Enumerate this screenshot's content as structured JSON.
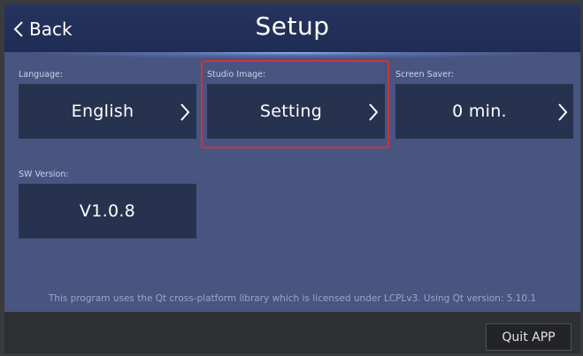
{
  "header": {
    "back_label": "Back",
    "title": "Setup"
  },
  "settings": {
    "language": {
      "label": "Language:",
      "value": "English"
    },
    "studio_image": {
      "label": "Studio Image:",
      "value": "Setting"
    },
    "screen_saver": {
      "label": "Screen Saver:",
      "value": "0 min."
    },
    "sw_version": {
      "label": "SW Version:",
      "value": "V1.0.8"
    }
  },
  "footer": {
    "license_text": "This program uses the Qt cross-platform library which is licensed under LCPLv3. Using Qt version: 5.10.1",
    "quit_label": "Quit APP"
  },
  "colors": {
    "panel_bg": "#485581",
    "header_bg": "#26345e",
    "tile_bg": "#27324f",
    "highlight": "#d1303a"
  },
  "icons": {
    "back": "chevron-left-icon",
    "tile_arrow": "chevron-right-icon"
  }
}
